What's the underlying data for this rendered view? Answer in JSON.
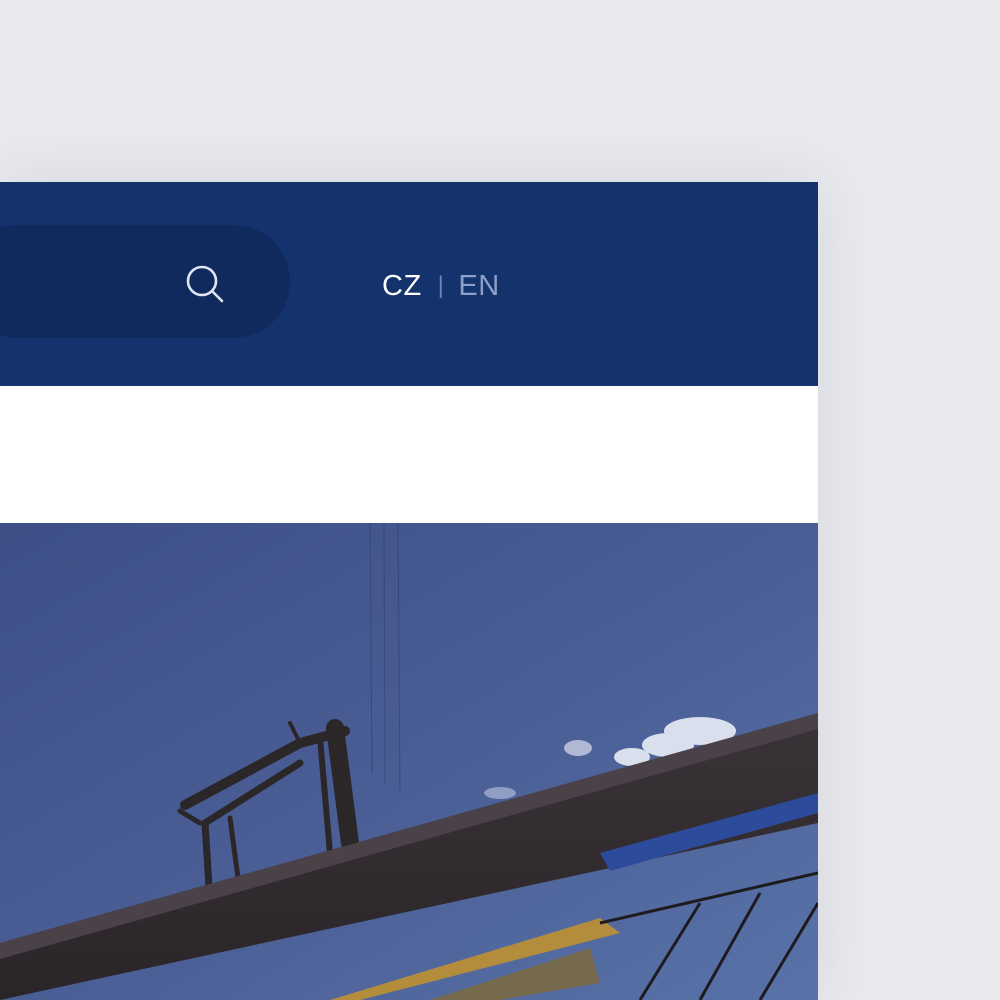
{
  "header": {
    "search": {
      "icon": "search-icon"
    },
    "languages": {
      "current": "CZ",
      "separator": "|",
      "other": "EN"
    }
  },
  "hero": {
    "image": "industrial-structure-photo"
  },
  "colors": {
    "header_bg": "#14336d",
    "search_bg": "#112a5e",
    "page_bg": "#e9eaee",
    "lang_active": "#ffffff",
    "lang_inactive": "#8e9fc7"
  }
}
